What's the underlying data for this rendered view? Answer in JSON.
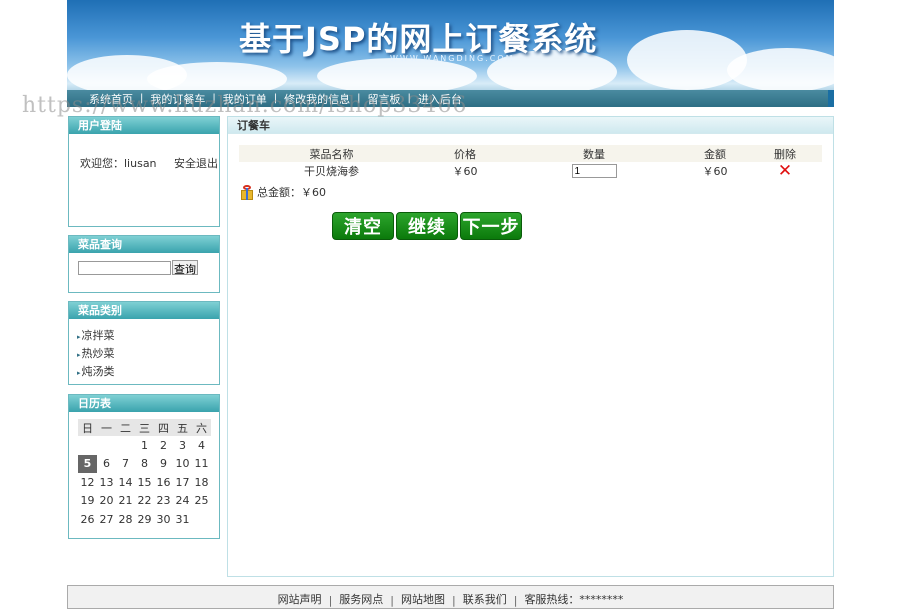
{
  "banner": {
    "title": "基于JSP的网上订餐系统",
    "subtitle": "WWW.WANGDING.COM"
  },
  "nav": [
    {
      "label": "系统首页"
    },
    {
      "label": "我的订餐车"
    },
    {
      "label": "我的订单"
    },
    {
      "label": "修改我的信息"
    },
    {
      "label": "留言板"
    },
    {
      "label": "进入后台"
    }
  ],
  "nav_separator": "|",
  "watermark": "https://www.huzhan.com/ishop33466",
  "sidebar": {
    "user": {
      "title": "用户登陆",
      "welcome": "欢迎您：liusan",
      "logout": "安全退出"
    },
    "search": {
      "title": "菜品查询",
      "input_value": "",
      "button": "查询"
    },
    "categories": {
      "title": "菜品类别",
      "items": [
        {
          "label": "凉拌菜"
        },
        {
          "label": "热炒菜"
        },
        {
          "label": "炖汤类"
        }
      ]
    },
    "calendar": {
      "title": "日历表",
      "weekdays": [
        "日",
        "一",
        "二",
        "三",
        "四",
        "五",
        "六"
      ],
      "rows": [
        [
          "",
          "",
          "",
          "1",
          "2",
          "3",
          "4"
        ],
        [
          "5",
          "6",
          "7",
          "8",
          "9",
          "10",
          "11"
        ],
        [
          "12",
          "13",
          "14",
          "15",
          "16",
          "17",
          "18"
        ],
        [
          "19",
          "20",
          "21",
          "22",
          "23",
          "24",
          "25"
        ],
        [
          "26",
          "27",
          "28",
          "29",
          "30",
          "31",
          ""
        ]
      ],
      "today": "5"
    }
  },
  "main": {
    "title": "订餐车",
    "columns": {
      "name": "菜品名称",
      "price": "价格",
      "qty": "数量",
      "amount": "金额",
      "delete": "删除"
    },
    "items": [
      {
        "name": "干贝烧海参",
        "price": "￥60",
        "qty": "1",
        "amount": "￥60"
      }
    ],
    "total_label": "总金额：￥60",
    "buttons": {
      "clear": "清空",
      "continue": "继续",
      "next": "下一步"
    }
  },
  "footer": {
    "links": [
      {
        "label": "网站声明"
      },
      {
        "label": "服务网点"
      },
      {
        "label": "网站地图"
      },
      {
        "label": "联系我们"
      },
      {
        "label": "客服热线：********"
      }
    ]
  }
}
